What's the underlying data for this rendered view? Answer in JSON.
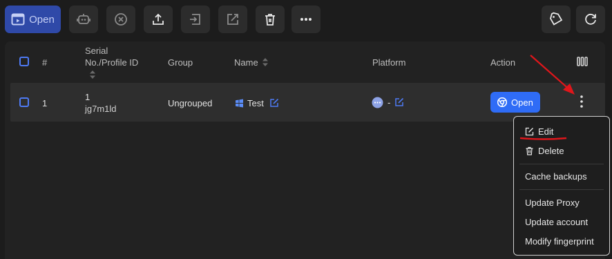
{
  "toolbar": {
    "open_label": "Open",
    "buttons": [
      "robot-icon",
      "close-circle-icon",
      "upload-icon",
      "import-icon",
      "export-icon",
      "trash-icon",
      "more-icon"
    ],
    "right_buttons": [
      "tag-icon",
      "refresh-icon"
    ]
  },
  "table": {
    "headers": {
      "index": "#",
      "serial_line1": "Serial",
      "serial_line2": "No./Profile ID",
      "group": "Group",
      "name": "Name",
      "platform": "Platform",
      "action": "Action"
    },
    "rows": [
      {
        "index": "1",
        "serial": "1",
        "profile_id": "jg7m1ld",
        "group": "Ungrouped",
        "name": "Test",
        "platform": "-",
        "action_label": "Open"
      }
    ]
  },
  "context_menu": {
    "edit": "Edit",
    "delete": "Delete",
    "cache_backups": "Cache backups",
    "update_proxy": "Update Proxy",
    "update_account": "Update account",
    "modify_fingerprint": "Modify fingerprint"
  },
  "colors": {
    "accent": "#2f6cf6",
    "annotation": "#e0161b",
    "background": "#1c1c1c"
  }
}
